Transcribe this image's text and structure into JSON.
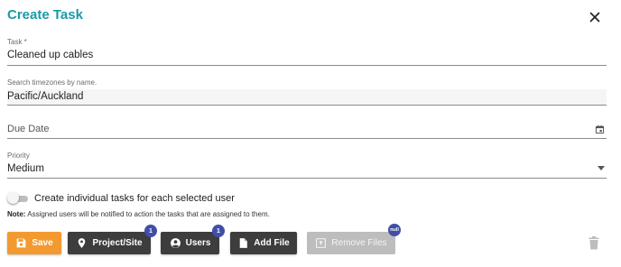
{
  "dialog": {
    "title": "Create Task",
    "close_icon": "close-icon"
  },
  "task": {
    "label": "Task *",
    "value": "Cleaned up cables"
  },
  "timezone": {
    "label": "Search timezones by name.",
    "value": "Pacific/Auckland"
  },
  "due_date": {
    "placeholder": "Due Date",
    "icon": "calendar-icon"
  },
  "priority": {
    "label": "Priority",
    "value": "Medium",
    "icon": "chevron-down-icon"
  },
  "individual_tasks_toggle": {
    "label": "Create individual tasks for each selected user",
    "checked": false
  },
  "note": {
    "prefix": "Note:",
    "text": "Assigned users will be notified to action the tasks that are assigned to them."
  },
  "buttons": {
    "save": {
      "label": "Save",
      "icon": "floppy-disk-icon"
    },
    "project_site": {
      "label": "Project/Site",
      "icon": "map-marker-icon",
      "badge": "1"
    },
    "users": {
      "label": "Users",
      "icon": "account-circle-icon",
      "badge": "1"
    },
    "add_file": {
      "label": "Add File",
      "icon": "file-icon"
    },
    "remove_files": {
      "label": "Remove Files",
      "icon": "file-remove-icon",
      "badge": "null"
    },
    "delete_icon": "trash-icon"
  },
  "colors": {
    "title": "#1a9aa8",
    "save_button": "#f39a2f",
    "dark_button": "#3d3d3d",
    "disabled_button": "#bdbdbd",
    "badge": "#3f4fa8"
  }
}
